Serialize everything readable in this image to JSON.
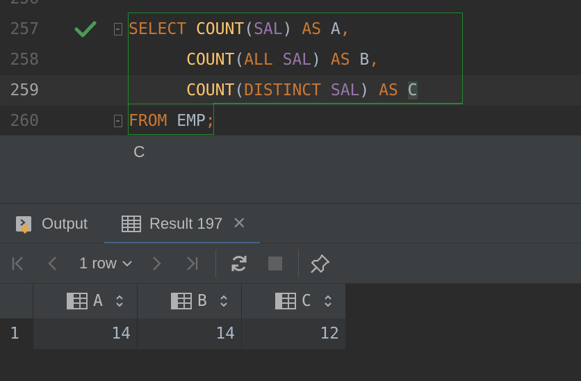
{
  "editor": {
    "lines": [
      {
        "num": "256"
      },
      {
        "num": "257",
        "tokens": [
          {
            "t": "SELECT",
            "c": "kw"
          },
          {
            "t": " ",
            "c": "plain"
          },
          {
            "t": "COUNT",
            "c": "fn"
          },
          {
            "t": "(",
            "c": "plain"
          },
          {
            "t": "SAL",
            "c": "col"
          },
          {
            "t": ") ",
            "c": "plain"
          },
          {
            "t": "AS",
            "c": "kw"
          },
          {
            "t": " A",
            "c": "plain"
          },
          {
            "t": ",",
            "c": "kw"
          }
        ]
      },
      {
        "num": "258",
        "tokens": [
          {
            "t": "      ",
            "c": "plain"
          },
          {
            "t": "COUNT",
            "c": "fn"
          },
          {
            "t": "(",
            "c": "plain"
          },
          {
            "t": "ALL",
            "c": "kw"
          },
          {
            "t": " ",
            "c": "plain"
          },
          {
            "t": "SAL",
            "c": "col"
          },
          {
            "t": ") ",
            "c": "plain"
          },
          {
            "t": "AS",
            "c": "kw"
          },
          {
            "t": " B",
            "c": "plain"
          },
          {
            "t": ",",
            "c": "kw"
          }
        ]
      },
      {
        "num": "259",
        "tokens": [
          {
            "t": "      ",
            "c": "plain"
          },
          {
            "t": "COUNT",
            "c": "fn"
          },
          {
            "t": "(",
            "c": "plain"
          },
          {
            "t": "DISTINCT",
            "c": "kw"
          },
          {
            "t": " ",
            "c": "plain"
          },
          {
            "t": "SAL",
            "c": "col"
          },
          {
            "t": ") ",
            "c": "plain"
          },
          {
            "t": "AS",
            "c": "kw"
          },
          {
            "t": " ",
            "c": "plain"
          },
          {
            "t": "C",
            "c": "plain caret-cell"
          }
        ]
      },
      {
        "num": "260",
        "tokens": [
          {
            "t": "FROM",
            "c": "kw"
          },
          {
            "t": " EMP",
            "c": "plain"
          },
          {
            "t": ";",
            "c": "kw"
          }
        ]
      }
    ],
    "completion_item": "C",
    "colors": {
      "keyword": "#cc7832",
      "function": "#ffc66d",
      "column": "#9876aa",
      "plain": "#a9b7c6",
      "check": "#499c54"
    }
  },
  "tabs": {
    "output_label": "Output",
    "result_label": "Result 197",
    "output_icon": "output-console-icon",
    "result_icon": "table-grid-icon"
  },
  "toolbar": {
    "row_count": "1 row",
    "icons": [
      "first-page-icon",
      "previous-page-icon",
      "next-page-icon",
      "last-page-icon",
      "refresh-icon",
      "stop-icon",
      "pin-icon"
    ]
  },
  "grid": {
    "columns": [
      "A",
      "B",
      "C"
    ],
    "rows": [
      {
        "num": "1",
        "cells": [
          "14",
          "14",
          "12"
        ]
      }
    ]
  }
}
